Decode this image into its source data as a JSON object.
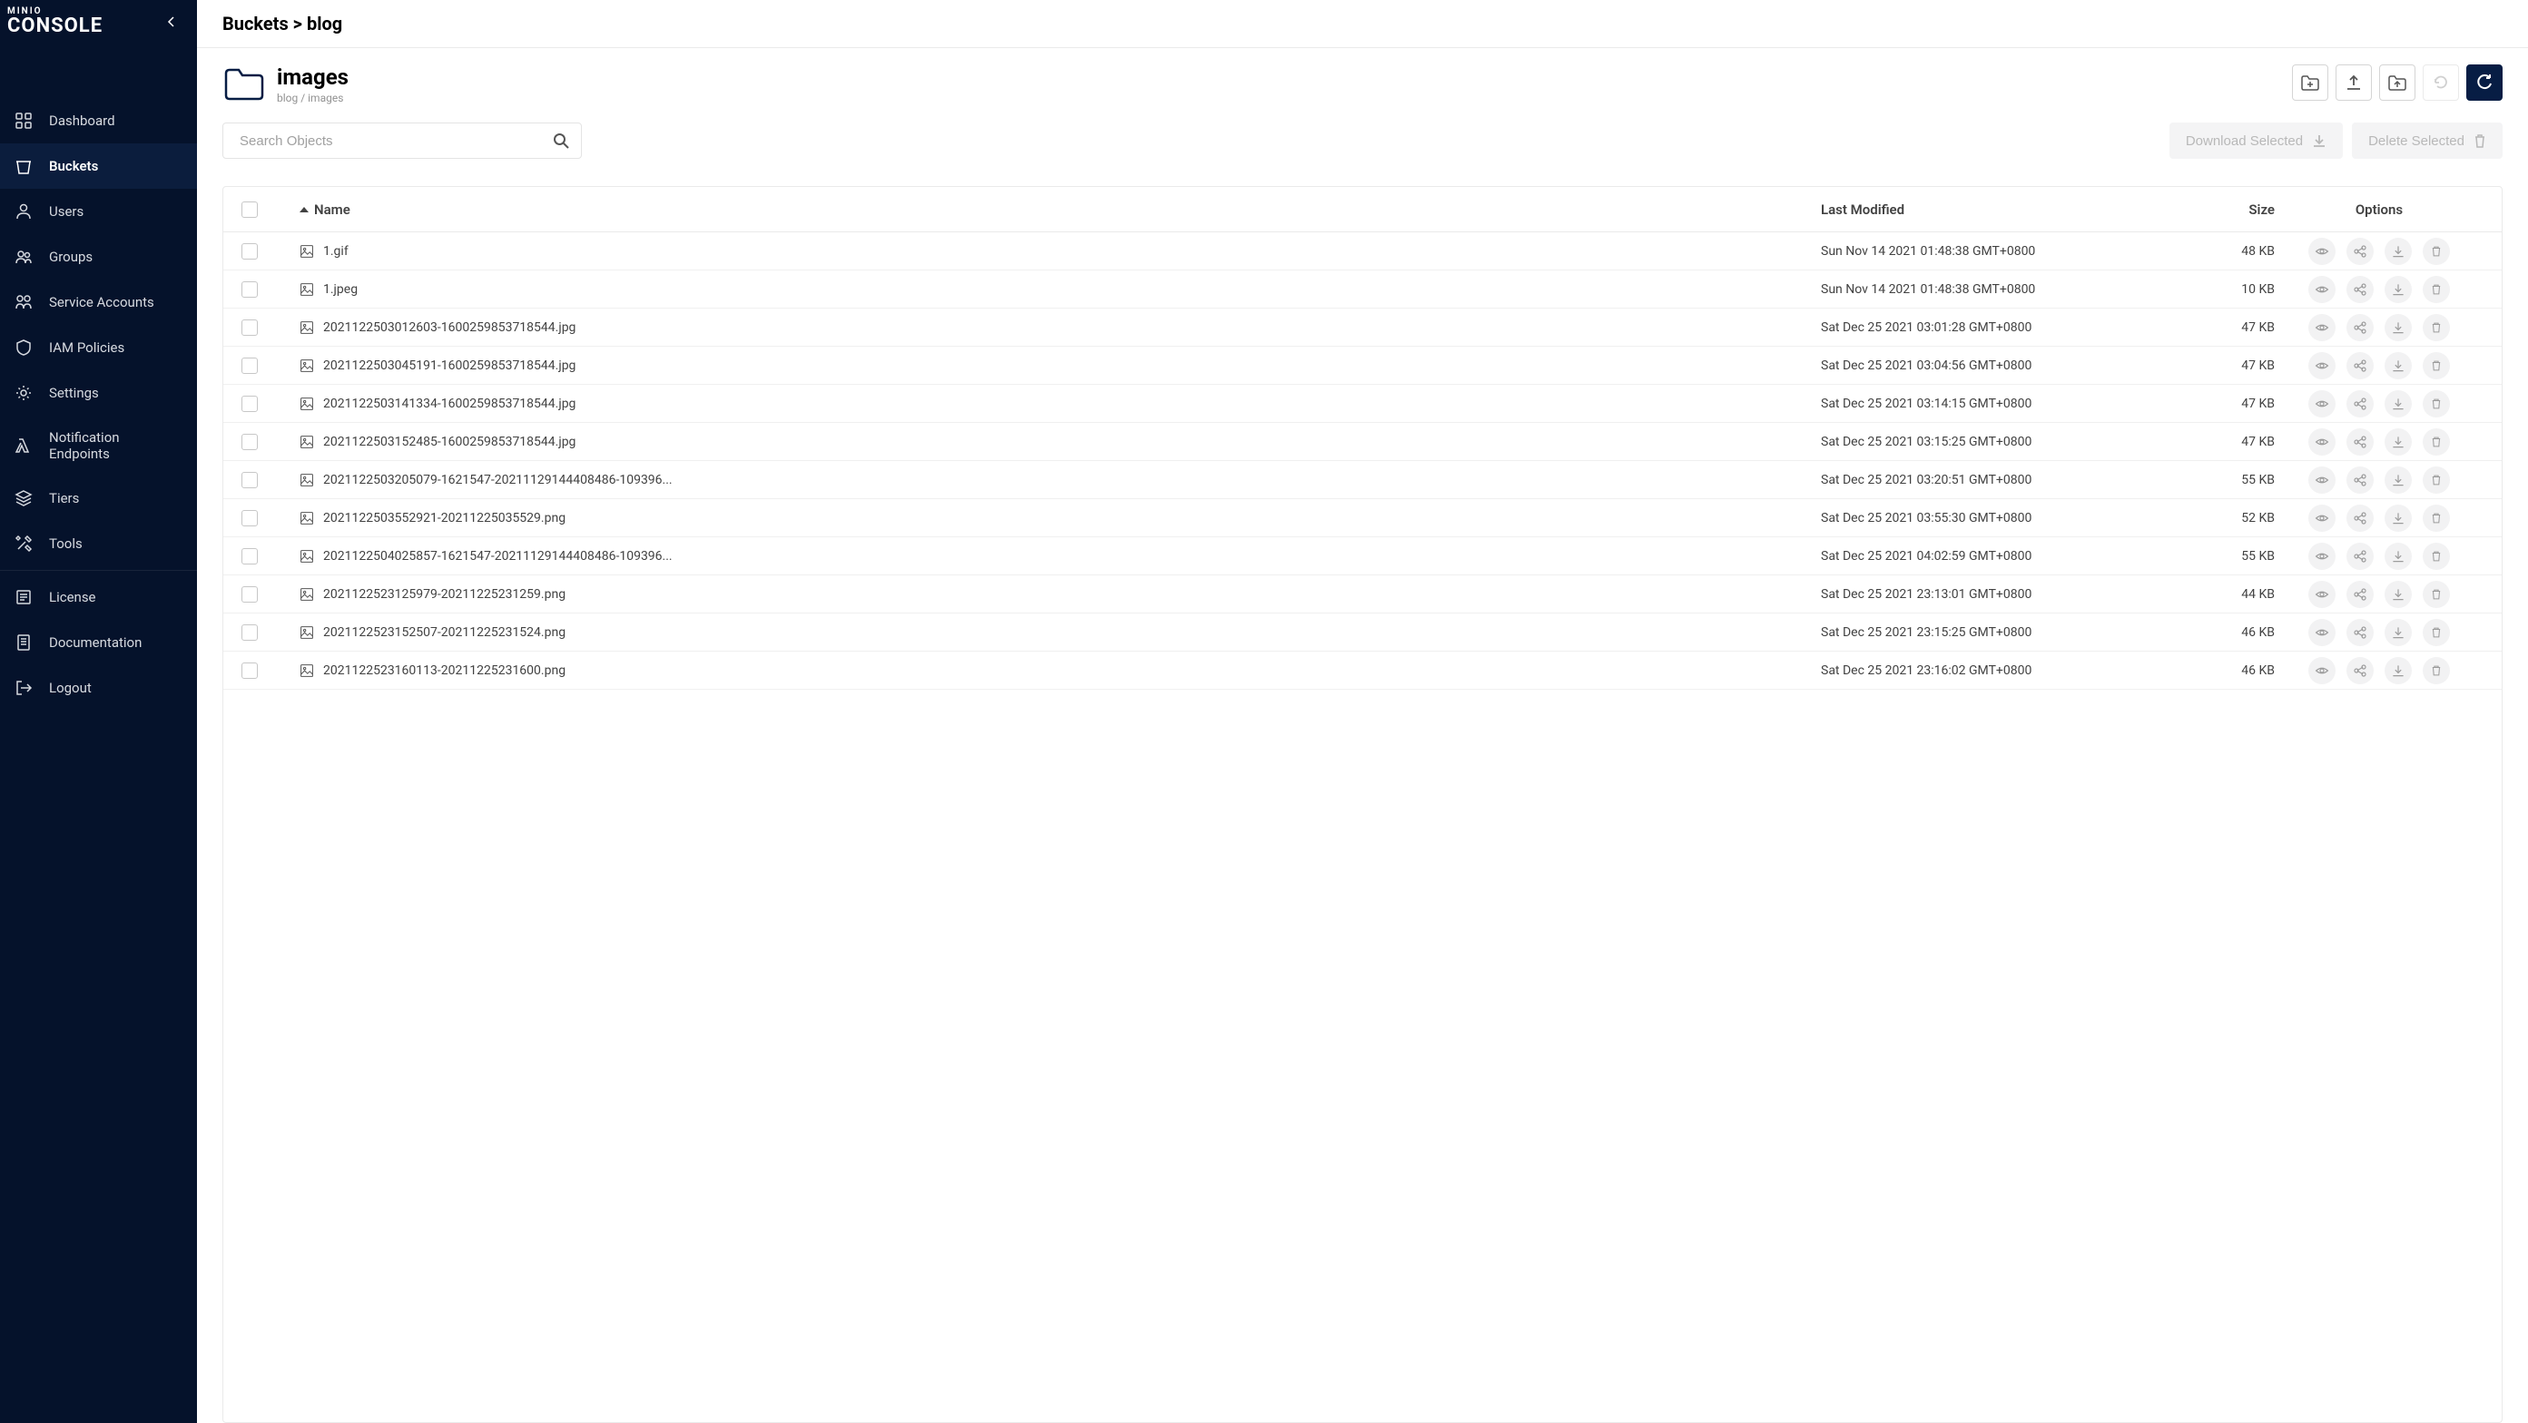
{
  "brand": {
    "top": "MINIO",
    "bottom": "CONSOLE"
  },
  "sidebar": {
    "items": [
      {
        "label": "Dashboard",
        "icon": "dashboard-icon"
      },
      {
        "label": "Buckets",
        "icon": "bucket-icon",
        "active": true
      },
      {
        "label": "Users",
        "icon": "user-icon"
      },
      {
        "label": "Groups",
        "icon": "groups-icon"
      },
      {
        "label": "Service Accounts",
        "icon": "service-accounts-icon"
      },
      {
        "label": "IAM Policies",
        "icon": "shield-icon"
      },
      {
        "label": "Settings",
        "icon": "gear-icon"
      },
      {
        "label": "Notification Endpoints",
        "icon": "lambda-icon"
      },
      {
        "label": "Tiers",
        "icon": "layers-icon"
      },
      {
        "label": "Tools",
        "icon": "tools-icon"
      }
    ],
    "footer": [
      {
        "label": "License",
        "icon": "license-icon"
      },
      {
        "label": "Documentation",
        "icon": "doc-icon"
      },
      {
        "label": "Logout",
        "icon": "logout-icon"
      }
    ]
  },
  "breadcrumb": "Buckets > blog",
  "folder": {
    "title": "images",
    "path": "blog / images"
  },
  "search": {
    "placeholder": "Search Objects"
  },
  "actions": {
    "download": "Download Selected",
    "delete": "Delete Selected"
  },
  "columns": {
    "name": "Name",
    "modified": "Last Modified",
    "size": "Size",
    "options": "Options"
  },
  "rows": [
    {
      "name": "1.gif",
      "modified": "Sun Nov 14 2021 01:48:38 GMT+0800",
      "size": "48 KB"
    },
    {
      "name": "1.jpeg",
      "modified": "Sun Nov 14 2021 01:48:38 GMT+0800",
      "size": "10 KB"
    },
    {
      "name": "2021122503012603-1600259853718544.jpg",
      "modified": "Sat Dec 25 2021 03:01:28 GMT+0800",
      "size": "47 KB"
    },
    {
      "name": "2021122503045191-1600259853718544.jpg",
      "modified": "Sat Dec 25 2021 03:04:56 GMT+0800",
      "size": "47 KB"
    },
    {
      "name": "2021122503141334-1600259853718544.jpg",
      "modified": "Sat Dec 25 2021 03:14:15 GMT+0800",
      "size": "47 KB"
    },
    {
      "name": "2021122503152485-1600259853718544.jpg",
      "modified": "Sat Dec 25 2021 03:15:25 GMT+0800",
      "size": "47 KB"
    },
    {
      "name": "2021122503205079-1621547-20211129144408486-109396...",
      "modified": "Sat Dec 25 2021 03:20:51 GMT+0800",
      "size": "55 KB"
    },
    {
      "name": "2021122503552921-20211225035529.png",
      "modified": "Sat Dec 25 2021 03:55:30 GMT+0800",
      "size": "52 KB"
    },
    {
      "name": "2021122504025857-1621547-20211129144408486-109396...",
      "modified": "Sat Dec 25 2021 04:02:59 GMT+0800",
      "size": "55 KB"
    },
    {
      "name": "2021122523125979-20211225231259.png",
      "modified": "Sat Dec 25 2021 23:13:01 GMT+0800",
      "size": "44 KB"
    },
    {
      "name": "2021122523152507-20211225231524.png",
      "modified": "Sat Dec 25 2021 23:15:25 GMT+0800",
      "size": "46 KB"
    },
    {
      "name": "2021122523160113-20211225231600.png",
      "modified": "Sat Dec 25 2021 23:16:02 GMT+0800",
      "size": "46 KB"
    }
  ]
}
